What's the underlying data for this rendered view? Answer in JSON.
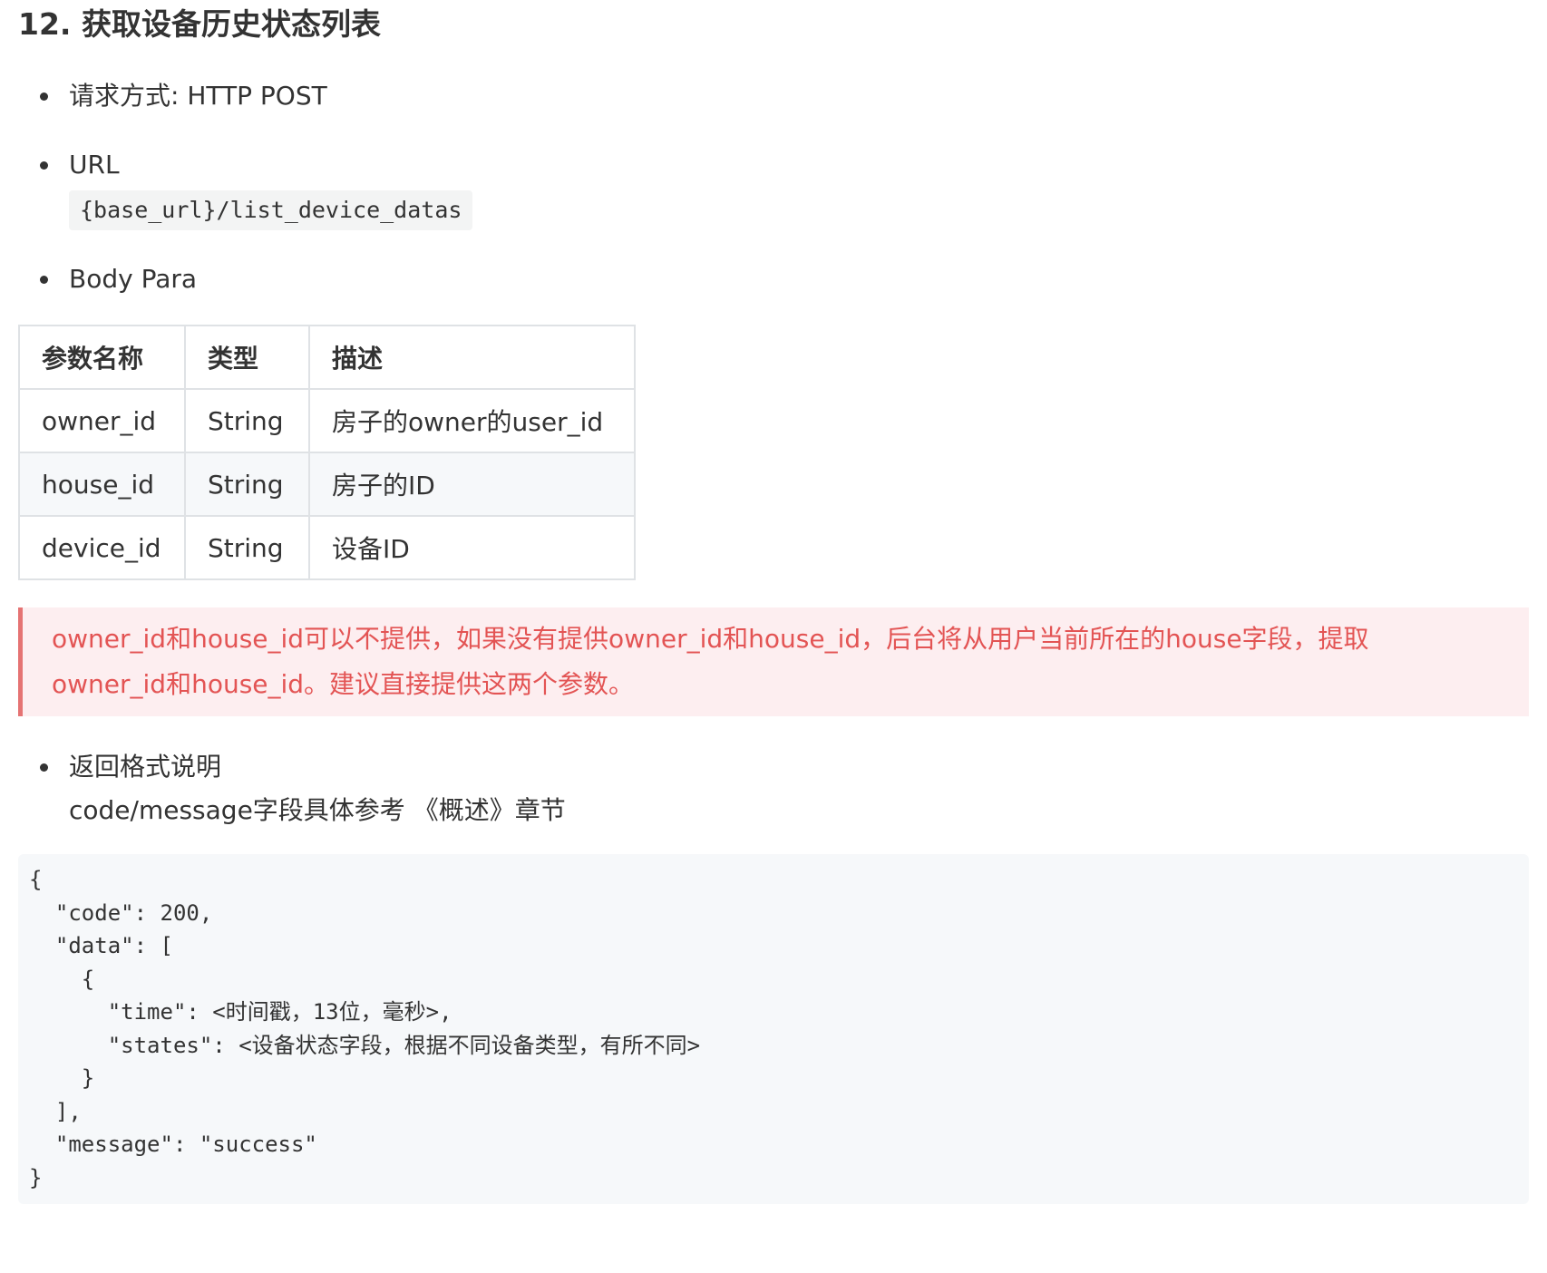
{
  "heading": "12. 获取设备历史状态列表",
  "items": {
    "method": "请求方式: HTTP POST",
    "url_label": "URL",
    "url_value": "{base_url}/list_device_datas",
    "body_label": "Body Para",
    "return_label": "返回格式说明",
    "return_desc": "code/message字段具体参考 《概述》章节"
  },
  "table": {
    "headers": [
      "参数名称",
      "类型",
      "描述"
    ],
    "rows": [
      [
        "owner_id",
        "String",
        "房子的owner的user_id"
      ],
      [
        "house_id",
        "String",
        "房子的ID"
      ],
      [
        "device_id",
        "String",
        "设备ID"
      ]
    ]
  },
  "note": {
    "line1": "owner_id和house_id可以不提供，如果没有提供owner_id和house_id，后台将从用户当前所在的house字段，提取",
    "line2": "owner_id和house_id。建议直接提供这两个参数。"
  },
  "code": "{\n  \"code\": 200,\n  \"data\": [\n    {\n      \"time\": <时间戳，13位，毫秒>,\n      \"states\": <设备状态字段，根据不同设备类型，有所不同>\n    }\n  ],\n  \"message\": \"success\"\n}",
  "colors": {
    "text": "#333333",
    "note_text": "#e35454",
    "note_bg": "#fdeef0",
    "note_border": "#e57373",
    "code_bg": "#f6f8fa",
    "table_border": "#dfe2e5"
  }
}
